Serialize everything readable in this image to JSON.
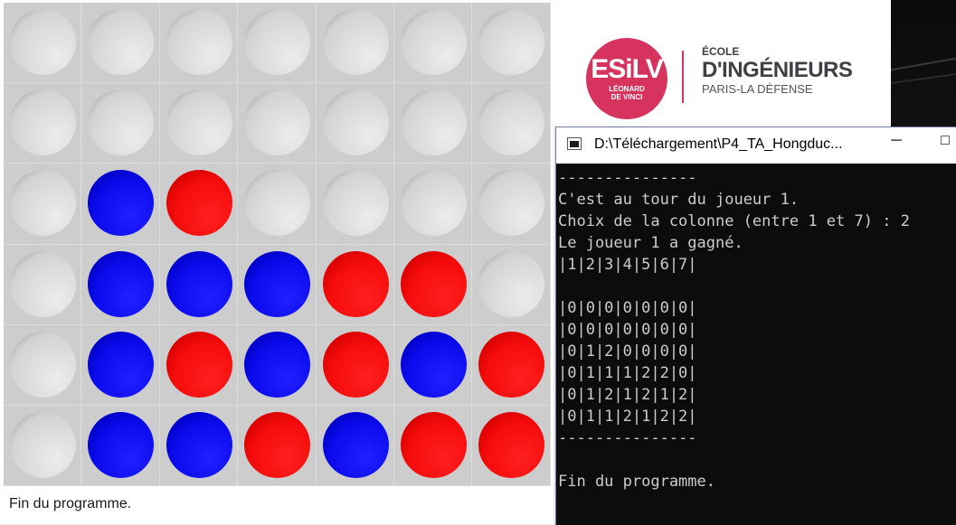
{
  "game": {
    "board": [
      [
        "empty",
        "empty",
        "empty",
        "empty",
        "empty",
        "empty",
        "empty"
      ],
      [
        "empty",
        "empty",
        "empty",
        "empty",
        "empty",
        "empty",
        "empty"
      ],
      [
        "empty",
        "blue",
        "red",
        "empty",
        "empty",
        "empty",
        "empty"
      ],
      [
        "empty",
        "blue",
        "blue",
        "blue",
        "red",
        "red",
        "empty"
      ],
      [
        "empty",
        "blue",
        "red",
        "blue",
        "red",
        "blue",
        "red"
      ],
      [
        "empty",
        "blue",
        "blue",
        "red",
        "blue",
        "red",
        "red"
      ]
    ],
    "status": "Fin du programme."
  },
  "logo": {
    "main": "ESiLV",
    "sub_line1": "LÉONARD",
    "sub_line2": "DE VINCI",
    "line1": "ÉCOLE",
    "line2": "D'INGÉNIEURS",
    "line3": "PARIS-LA DÉFENSE"
  },
  "console": {
    "title": "D:\\Téléchargement\\P4_TA_Hongduc...",
    "minimize_glyph": "─",
    "maximize_glyph": "□",
    "lines": [
      "---------------",
      "C'est au tour du joueur 1.",
      "Choix de la colonne (entre 1 et 7) : 2",
      "Le joueur 1 a gagné.",
      "|1|2|3|4|5|6|7|",
      "",
      "|0|0|0|0|0|0|0|",
      "|0|0|0|0|0|0|0|",
      "|0|1|2|0|0|0|0|",
      "|0|1|1|1|2|2|0|",
      "|0|1|2|1|2|1|2|",
      "|0|1|1|2|1|2|2|",
      "---------------",
      "",
      "Fin du programme."
    ]
  },
  "colors": {
    "player1": "#0000ff",
    "player2": "#ff0000",
    "empty": "#d4d4d4",
    "brand": "#d7335f"
  }
}
